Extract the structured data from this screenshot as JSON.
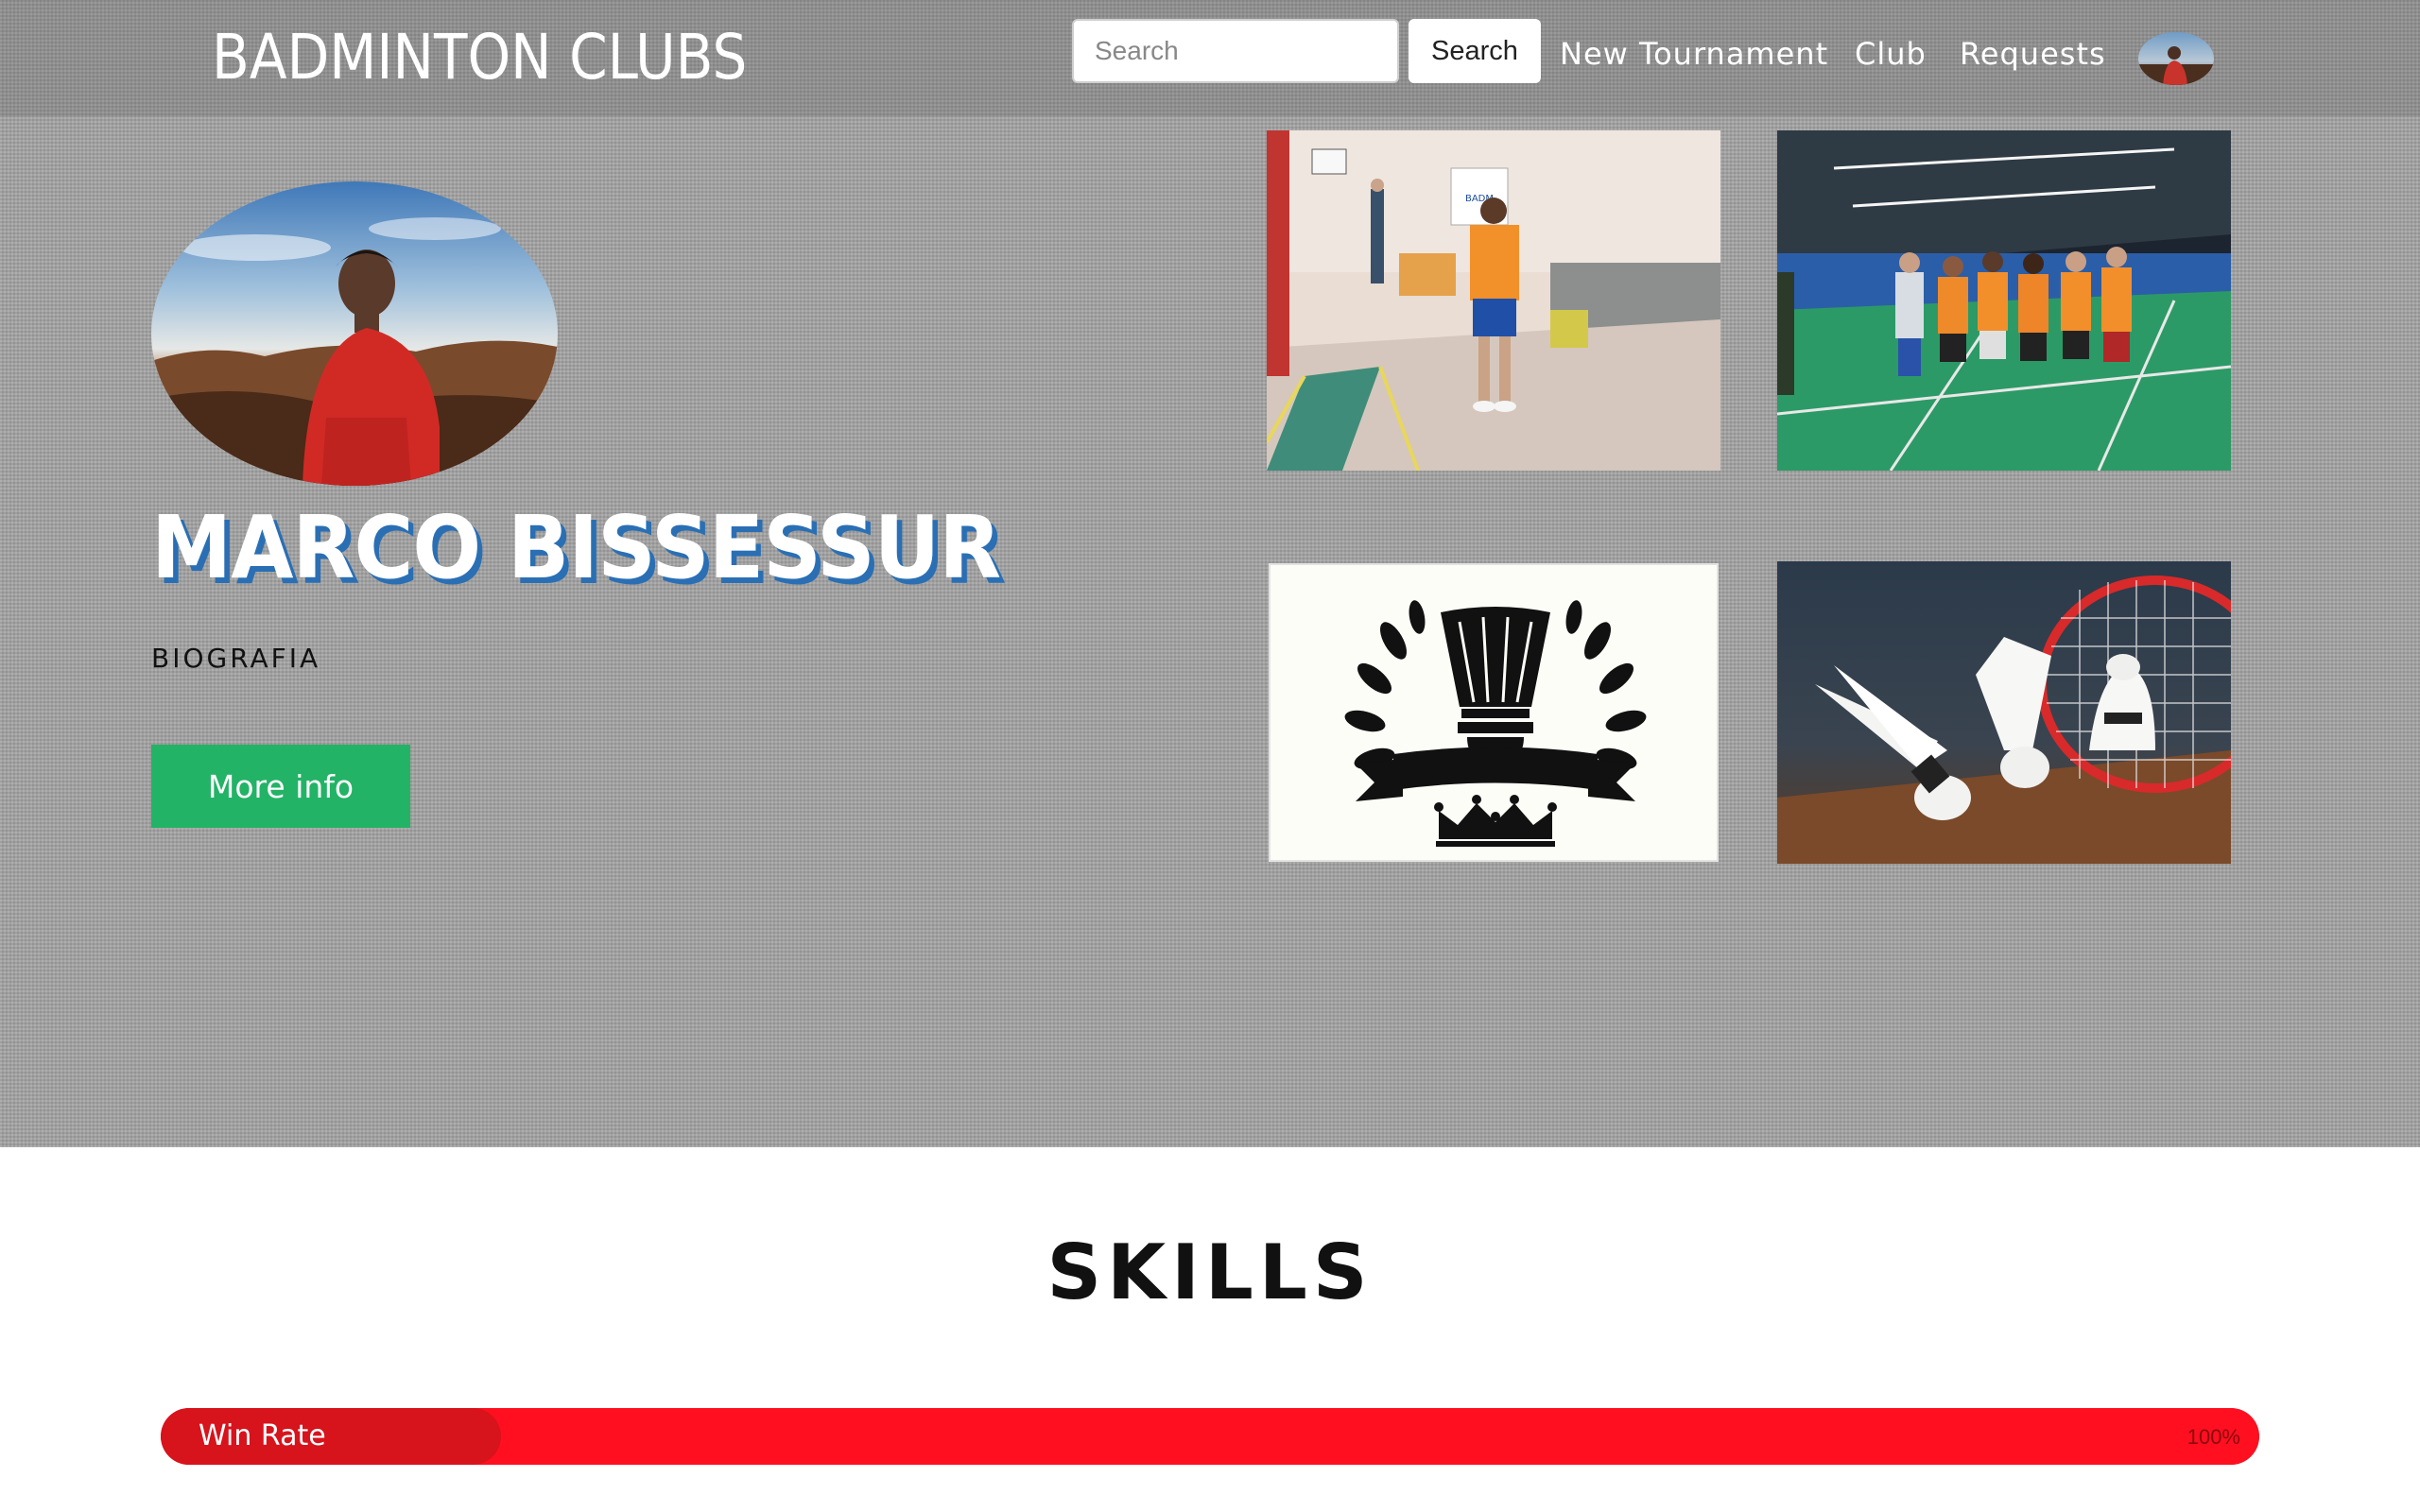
{
  "navbar": {
    "brand": "BADMINTON CLUBS",
    "search_placeholder": "Search",
    "search_button": "Search",
    "links": [
      "New Tournament",
      "Club",
      "Requests"
    ]
  },
  "profile": {
    "name": "MARCO BISSESSUR",
    "bio_label": "BIOGRAFIA",
    "more_info_button": "More info"
  },
  "gallery": [
    {
      "icon": "photo-trophy-icon"
    },
    {
      "icon": "photo-team-icon"
    },
    {
      "icon": "club-logo-icon"
    },
    {
      "icon": "shuttlecock-racket-icon"
    }
  ],
  "skills": {
    "title": "SKILLS",
    "items": [
      {
        "label": "Win Rate",
        "percent_text": "100%",
        "value": 1.0
      }
    ]
  },
  "colors": {
    "navbar": "#8e8e8e",
    "hero_bg": "#a3a3a3",
    "name_shadow": "#2a6fb4",
    "more_button": "#23b366",
    "skill_bar": "#ee1b24"
  }
}
